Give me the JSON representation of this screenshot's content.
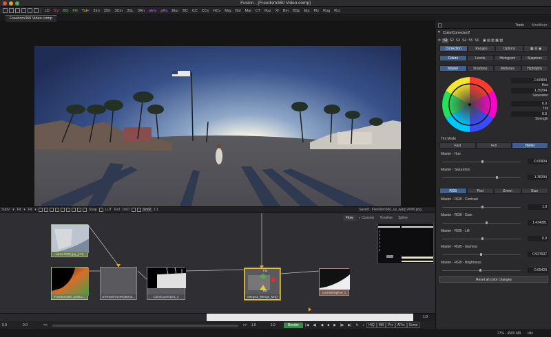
{
  "window": {
    "title": "Fusion - [Freedom360 Video.comp]"
  },
  "toolbar": {
    "items": [
      {
        "label": "LD",
        "color": "default"
      },
      {
        "label": "SV",
        "color": "red"
      },
      {
        "label": "BG",
        "color": "green"
      },
      {
        "label": "FN",
        "color": "green"
      },
      {
        "label": "Txt+",
        "color": "yellow"
      },
      {
        "label": "3Im",
        "color": "default"
      },
      {
        "label": "3Sh",
        "color": "default"
      },
      {
        "label": "3Cm",
        "color": "default"
      },
      {
        "label": "3SL",
        "color": "default"
      },
      {
        "label": "3Rn",
        "color": "default"
      },
      {
        "label": "pEm",
        "color": "mag"
      },
      {
        "label": "pRn",
        "color": "mag"
      },
      {
        "label": "Blur",
        "color": "default"
      },
      {
        "label": "BC",
        "color": "default"
      },
      {
        "label": "CC",
        "color": "default"
      },
      {
        "label": "CCv",
        "color": "default"
      },
      {
        "label": "HCv",
        "color": "default"
      },
      {
        "label": "Mrg",
        "color": "default"
      },
      {
        "label": "Bol",
        "color": "default"
      },
      {
        "label": "Mat",
        "color": "default"
      },
      {
        "label": "CT",
        "color": "default"
      },
      {
        "label": "Rsz",
        "color": "default"
      },
      {
        "label": "Xf",
        "color": "default"
      },
      {
        "label": "Bm",
        "color": "default"
      },
      {
        "label": "BSp",
        "color": "default"
      },
      {
        "label": "Elp",
        "color": "default"
      },
      {
        "label": "Ply",
        "color": "default"
      },
      {
        "label": "Rng",
        "color": "default"
      },
      {
        "label": "Rct",
        "color": "default"
      }
    ]
  },
  "comp_tab": "Freedom360 Video.comp",
  "viewer_toolbar": {
    "subv": "SubV",
    "fit1": "Fit",
    "fit2": "Fit",
    "snap": "Snap",
    "lut": "LUT",
    "roi": "RoI",
    "dod": "DoD",
    "smr": "SmR",
    "ratio": "1:1",
    "saver_label": "Saver1: Freedom360_uv_warp.####.png"
  },
  "flow": {
    "tabs": [
      "Flow",
      "Console",
      "Timeline",
      "Spline"
    ],
    "nodes": [
      {
        "name": "node-cam3",
        "label": "cam3.####.jpg_(LD)"
      },
      {
        "name": "node-freedom360",
        "label": "Freedom360_unstric..."
      },
      {
        "name": "node-uvpass",
        "label": "UVPassFromRGBIma..."
      },
      {
        "name": "node-colorcorrector1",
        "label": "ColorCorrector1_2"
      },
      {
        "name": "node-merge",
        "label": "Merge3_(Merge_Mrg)"
      },
      {
        "name": "node-cam360spline",
        "label": "Cam360Spline_1"
      }
    ],
    "merge_fg": "FG",
    "merge_bg": "BG"
  },
  "ruler": {
    "start": "1",
    "end": "1.0"
  },
  "transport": {
    "start_time": "0.0",
    "cur_time": "0.0",
    "rev": "<<",
    "fwd": ">>",
    "end1": "1.0",
    "end2": "1.0",
    "render": "Render",
    "hiq": "HiQ",
    "mb": "MB",
    "prx": "Prx",
    "aprx": "APrx",
    "some": "Some"
  },
  "status": {
    "memory": "27% - 4500 MB",
    "state": "Idle"
  },
  "inspector": {
    "tools_tab": "Tools",
    "modifiers_tab": "Modifiers",
    "tool_name": "ColorCorrector2",
    "slots": [
      "S1",
      "S2",
      "S3",
      "S4",
      "S5",
      "S6"
    ],
    "main_tabs": [
      "Correction",
      "Ranges",
      "Options"
    ],
    "sub_tabs": [
      "Colors",
      "Levels",
      "Histogram",
      "Suppress"
    ],
    "range_tabs": [
      "Master",
      "Shadows",
      "Midtones",
      "Highlights"
    ],
    "wheel": {
      "hue_val": "-0.00904",
      "hue_lbl": "Hue",
      "sat_val": "1.35294",
      "sat_lbl": "Saturation",
      "tint_val": "0.0",
      "tint_lbl": "Tint",
      "strength_val": "0.0",
      "strength_lbl": "Strength"
    },
    "tint_mode": {
      "label": "Tint Mode",
      "options": [
        "Fast",
        "Full",
        "Better"
      ],
      "selected": "Better"
    },
    "params": [
      {
        "label": "Master - Hue",
        "value": "-0.00904",
        "pos": 0.5
      },
      {
        "label": "Master - Saturation",
        "value": "1.35294",
        "pos": 0.68
      }
    ],
    "channel_tabs": [
      "RGB",
      "Red",
      "Green",
      "Blue"
    ],
    "rgb_params": [
      {
        "label": "Master - RGB - Contrast",
        "value": "1.0",
        "pos": 0.5
      },
      {
        "label": "Master - RGB - Gain",
        "value": "1.434381",
        "pos": 0.55
      },
      {
        "label": "Master - RGB - Lift",
        "value": "0.0",
        "pos": 0.5
      },
      {
        "label": "Master - RGB - Gamma",
        "value": "0.927607",
        "pos": 0.48
      },
      {
        "label": "Master - RGB - Brightness",
        "value": "-0.05429",
        "pos": 0.47
      }
    ],
    "reset_label": "Reset all color changes"
  },
  "colors": {
    "accent": "#41608e",
    "node_selected": "#e8c53a",
    "status_yellow": "#e8d14d"
  }
}
